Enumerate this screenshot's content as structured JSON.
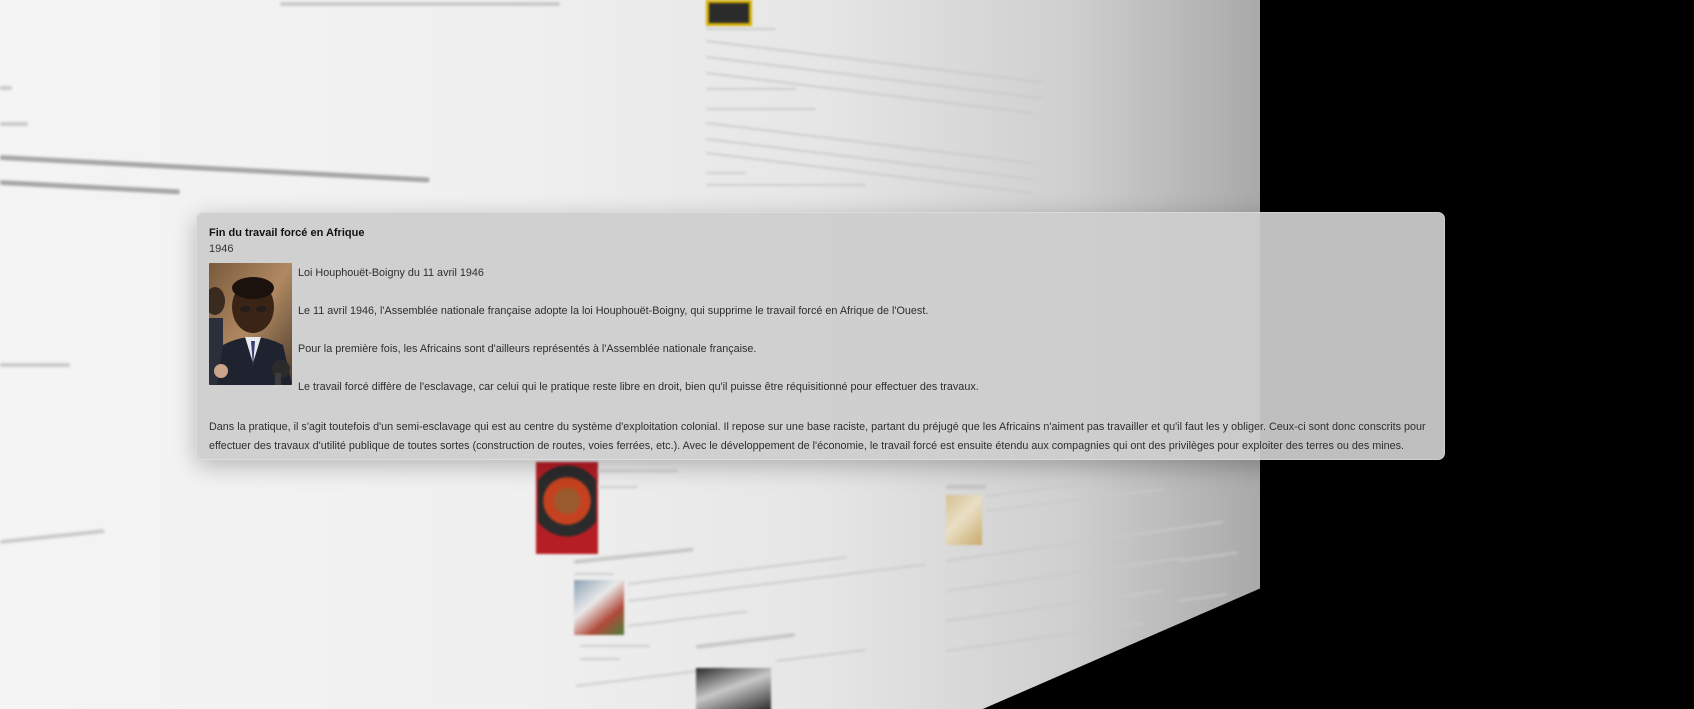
{
  "card": {
    "title": "Fin du travail forcé en Afrique",
    "date": "1946",
    "paragraphs": [
      "Loi Houphouët-Boigny du 11 avril 1946",
      "Le 11 avril 1946, l'Assemblée nationale française adopte la loi Houphouët-Boigny, qui supprime le travail forcé en Afrique de l'Ouest.",
      "Pour la première fois, les Africains sont d'ailleurs représentés à l'Assemblée nationale française.",
      "Le travail forcé diffère de l'esclavage, car celui qui le pratique reste libre en droit, bien qu'il puisse être réquisitionné pour effectuer des travaux."
    ],
    "wide_paragraph": "Dans la pratique, il s'agit toutefois d'un semi-esclavage qui est au centre du système d'exploitation colonial. Il repose sur une base raciste, partant du préjugé que les Africains n'aiment pas travailler et qu'il faut les y obliger. Ceux-ci sont donc conscrits pour effectuer des travaux d'utilité publique de toutes sortes (construction de routes, voies ferrées, etc.). Avec le développement de l'économie, le travail forcé est ensuite étendu aux compagnies qui ont des privilèges pour exploiter des terres ou des mines."
  },
  "photo": {
    "icon": "portrait-photo"
  },
  "colors": {
    "card_background": "#cdcdcd",
    "title_text": "#111111",
    "body_text": "#2e2e2e",
    "accent_red": "#b81e24"
  }
}
